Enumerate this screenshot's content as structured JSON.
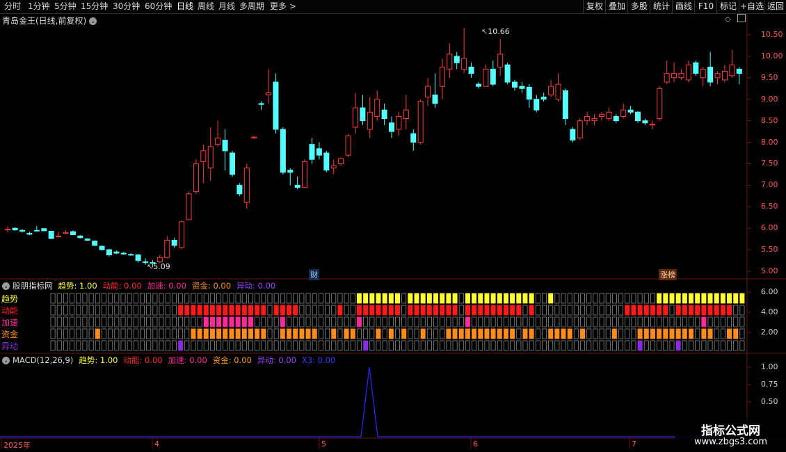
{
  "toolbar": {
    "periods": [
      "分时",
      "1分钟",
      "5分钟",
      "15分钟",
      "30分钟",
      "60分钟",
      "日线",
      "周线",
      "月线",
      "多周期",
      "更多 >"
    ],
    "selected": "日线",
    "right_buttons": [
      "复权",
      "叠加",
      "多股",
      "统计",
      "画线",
      "F10",
      "标记",
      "+自选",
      "返回"
    ]
  },
  "main_pane": {
    "title": "青岛金王(日线,前复权)",
    "title_icon": "chevron-down-icon",
    "price_ticks": [
      "10.50",
      "10.00",
      "9.50",
      "9.00",
      "8.50",
      "8.00",
      "7.50",
      "7.00",
      "6.50",
      "6.00",
      "5.50",
      "5.00"
    ],
    "high_label": "10.66",
    "low_label": "5.09",
    "markers": {
      "cai": "财",
      "zhangbang": "涨榜"
    }
  },
  "indicator_pane": {
    "title": "股朋指标网",
    "fields": [
      {
        "label": "趋势:",
        "value": "1.00",
        "color": "#ffff33"
      },
      {
        "label": "动能:",
        "value": "0.00",
        "color": "#ff2a2a"
      },
      {
        "label": "加速:",
        "value": "0.00",
        "color": "#ff2a9a"
      },
      {
        "label": "资金:",
        "value": "0.00",
        "color": "#ff9a1a"
      },
      {
        "label": "异动:",
        "value": "0.00",
        "color": "#a040ff"
      }
    ],
    "rows": [
      "趋势",
      "动能",
      "加速",
      "资金",
      "异动"
    ],
    "row_colors": [
      "#ffff33",
      "#ff1a1a",
      "#ff2a9a",
      "#ff8c1a",
      "#8a2be2"
    ],
    "y_ticks": [
      "6.00",
      "4.00",
      "2.00"
    ]
  },
  "macd_pane": {
    "title": "MACD(12,26,9)",
    "fields": [
      {
        "label": "趋势:",
        "value": "1.00",
        "color": "#ffff33"
      },
      {
        "label": "动能:",
        "value": "0.00",
        "color": "#ff2a2a"
      },
      {
        "label": "加速:",
        "value": "0.00",
        "color": "#ff2a9a"
      },
      {
        "label": "资金:",
        "value": "0.00",
        "color": "#ff9a1a"
      },
      {
        "label": "异动:",
        "value": "0.00",
        "color": "#a040ff"
      },
      {
        "label": "X3:",
        "value": "0.00",
        "color": "#3a3aff"
      }
    ],
    "y_ticks": [
      "1.00",
      "0.75",
      "0.50"
    ]
  },
  "x_axis": {
    "labels": [
      "2025年",
      "4",
      "5",
      "6",
      "7"
    ]
  },
  "watermark": {
    "line1": "指标公式网",
    "line2": "www.zbgs3.com"
  },
  "colors": {
    "up": "#ff3c3c",
    "down": "#54ffff",
    "grid": "#6a1414"
  },
  "chart_data": {
    "type": "candlestick",
    "y_range": [
      4.85,
      10.66
    ],
    "candles": [
      [
        5.96,
        6.05,
        5.98,
        5.9
      ],
      [
        6.0,
        6.02,
        5.96,
        5.94
      ],
      [
        5.95,
        5.98,
        5.93,
        5.9
      ],
      [
        5.88,
        5.92,
        5.86,
        5.84
      ],
      [
        5.95,
        6.05,
        5.94,
        5.92
      ],
      [
        5.99,
        6.0,
        5.94,
        5.93
      ],
      [
        5.93,
        5.94,
        5.76,
        5.75
      ],
      [
        5.8,
        5.92,
        5.82,
        5.78
      ],
      [
        5.88,
        5.95,
        5.9,
        5.86
      ],
      [
        5.92,
        5.95,
        5.85,
        5.84
      ],
      [
        5.82,
        5.84,
        5.78,
        5.76
      ],
      [
        5.75,
        5.77,
        5.72,
        5.7
      ],
      [
        5.7,
        5.72,
        5.6,
        5.58
      ],
      [
        5.58,
        5.6,
        5.5,
        5.48
      ],
      [
        5.5,
        5.52,
        5.38,
        5.34
      ],
      [
        5.45,
        5.48,
        5.42,
        5.4
      ],
      [
        5.42,
        5.45,
        5.4,
        5.38
      ],
      [
        5.39,
        5.42,
        5.38,
        5.36
      ],
      [
        5.38,
        5.4,
        5.25,
        5.2
      ],
      [
        5.22,
        5.3,
        5.2,
        5.15
      ],
      [
        5.2,
        5.26,
        5.19,
        5.09
      ],
      [
        5.22,
        5.38,
        5.32,
        5.18
      ],
      [
        5.32,
        5.82,
        5.72,
        5.3
      ],
      [
        5.72,
        5.78,
        5.6,
        5.55
      ],
      [
        5.55,
        6.18,
        6.15,
        5.52
      ],
      [
        6.2,
        6.85,
        6.8,
        6.2
      ],
      [
        6.85,
        7.6,
        7.5,
        6.8
      ],
      [
        7.55,
        7.95,
        7.8,
        7.05
      ],
      [
        7.4,
        8.35,
        7.9,
        7.1
      ],
      [
        7.95,
        8.5,
        8.1,
        7.9
      ],
      [
        8.05,
        8.3,
        7.8,
        7.35
      ],
      [
        7.75,
        7.8,
        7.25,
        7.2
      ],
      [
        7.0,
        7.05,
        6.8,
        6.75
      ],
      [
        6.6,
        7.5,
        7.4,
        6.45
      ],
      [
        8.1,
        8.15,
        8.12,
        8.08
      ],
      [
        8.9,
        8.95,
        8.88,
        8.75
      ],
      [
        9.1,
        9.7,
        9.15,
        8.9
      ],
      [
        9.4,
        9.6,
        8.3,
        8.2
      ],
      [
        8.3,
        8.35,
        7.3,
        7.25
      ],
      [
        7.35,
        7.4,
        7.3,
        7.0
      ],
      [
        7.0,
        7.2,
        6.95,
        6.9
      ],
      [
        6.95,
        7.6,
        7.55,
        6.95
      ],
      [
        7.95,
        8.1,
        7.6,
        7.5
      ],
      [
        7.85,
        8.0,
        7.7,
        7.6
      ],
      [
        7.75,
        7.8,
        7.35,
        7.3
      ],
      [
        7.4,
        7.6,
        7.45,
        7.25
      ],
      [
        7.5,
        7.65,
        7.62,
        7.45
      ],
      [
        7.7,
        8.2,
        8.15,
        7.65
      ],
      [
        8.35,
        9.15,
        8.8,
        8.2
      ],
      [
        8.8,
        9.1,
        8.5,
        8.4
      ],
      [
        8.3,
        9.05,
        8.7,
        8.1
      ],
      [
        8.6,
        9.2,
        9.0,
        8.5
      ],
      [
        8.75,
        8.9,
        8.55,
        8.4
      ],
      [
        8.45,
        8.6,
        8.25,
        8.1
      ],
      [
        8.3,
        8.7,
        8.6,
        8.15
      ],
      [
        8.55,
        9.1,
        8.75,
        8.3
      ],
      [
        8.2,
        8.3,
        8.0,
        7.8
      ],
      [
        8.0,
        9.0,
        8.95,
        7.95
      ],
      [
        9.05,
        9.5,
        9.3,
        8.85
      ],
      [
        9.1,
        9.6,
        8.9,
        8.8
      ],
      [
        9.3,
        9.95,
        9.75,
        9.0
      ],
      [
        9.7,
        10.3,
        10.05,
        9.5
      ],
      [
        10.0,
        10.1,
        9.85,
        9.7
      ],
      [
        9.7,
        10.66,
        9.95,
        9.6
      ],
      [
        9.75,
        9.85,
        9.6,
        9.5
      ],
      [
        9.35,
        9.4,
        9.3,
        9.25
      ],
      [
        9.3,
        9.8,
        9.7,
        9.3
      ],
      [
        9.7,
        9.9,
        9.35,
        9.3
      ],
      [
        9.75,
        10.4,
        10.05,
        9.55
      ],
      [
        9.8,
        9.85,
        9.4,
        9.35
      ],
      [
        9.4,
        9.45,
        9.28,
        9.2
      ],
      [
        9.3,
        9.4,
        9.25,
        9.15
      ],
      [
        9.28,
        9.35,
        9.0,
        8.8
      ],
      [
        9.0,
        9.1,
        8.75,
        8.7
      ],
      [
        9.05,
        9.15,
        9.0,
        8.95
      ],
      [
        9.1,
        9.45,
        9.3,
        9.05
      ],
      [
        9.0,
        9.6,
        9.35,
        8.95
      ],
      [
        9.2,
        9.25,
        8.55,
        8.4
      ],
      [
        8.3,
        8.35,
        8.05,
        8.0
      ],
      [
        8.1,
        8.55,
        8.5,
        8.05
      ],
      [
        8.5,
        8.7,
        8.6,
        8.4
      ],
      [
        8.5,
        8.65,
        8.55,
        8.4
      ],
      [
        8.6,
        8.7,
        8.65,
        8.5
      ],
      [
        8.55,
        8.8,
        8.7,
        8.5
      ],
      [
        8.6,
        8.65,
        8.5,
        8.45
      ],
      [
        8.6,
        8.9,
        8.75,
        8.55
      ],
      [
        8.75,
        8.85,
        8.7,
        8.65
      ],
      [
        8.7,
        8.72,
        8.5,
        8.45
      ],
      [
        8.5,
        8.55,
        8.45,
        8.4
      ],
      [
        8.4,
        8.5,
        8.42,
        8.3
      ],
      [
        8.55,
        9.3,
        9.25,
        8.5
      ],
      [
        9.4,
        9.9,
        9.6,
        9.35
      ],
      [
        9.5,
        9.85,
        9.6,
        9.4
      ],
      [
        9.5,
        9.7,
        9.6,
        9.45
      ],
      [
        9.45,
        9.9,
        9.8,
        9.4
      ],
      [
        9.85,
        9.9,
        9.6,
        9.55
      ],
      [
        9.5,
        9.75,
        9.7,
        9.3
      ],
      [
        9.75,
        10.1,
        9.4,
        9.3
      ],
      [
        9.5,
        9.65,
        9.6,
        9.35
      ],
      [
        9.45,
        9.8,
        9.65,
        9.4
      ],
      [
        9.55,
        10.15,
        9.8,
        9.5
      ],
      [
        9.7,
        9.75,
        9.6,
        9.35
      ]
    ],
    "indicator_rows": {
      "trend": "0000000000000000000000000000000000000000000000001111111011111111011111111111001000000000000000011111111111111",
      "energy": "0000000000000000000011111111111111011110000001001111111011111111011111111101000000000000001111111011111111100",
      "accel": "0000000000000000000000001111111100001000000000001000000000000000010000000000000000000000000000000000001000000",
      "fund": "0000000100000000000000111111111111001111110010110001010100100011111111111011001111010000100011111111101100110",
      "anomaly": "0000000000000000000010000000000000000000000000000100000000000000000000000000000000000000000010000010000000000"
    },
    "macd_line": {
      "spike_value": 1.0,
      "baseline": 0.0
    }
  }
}
